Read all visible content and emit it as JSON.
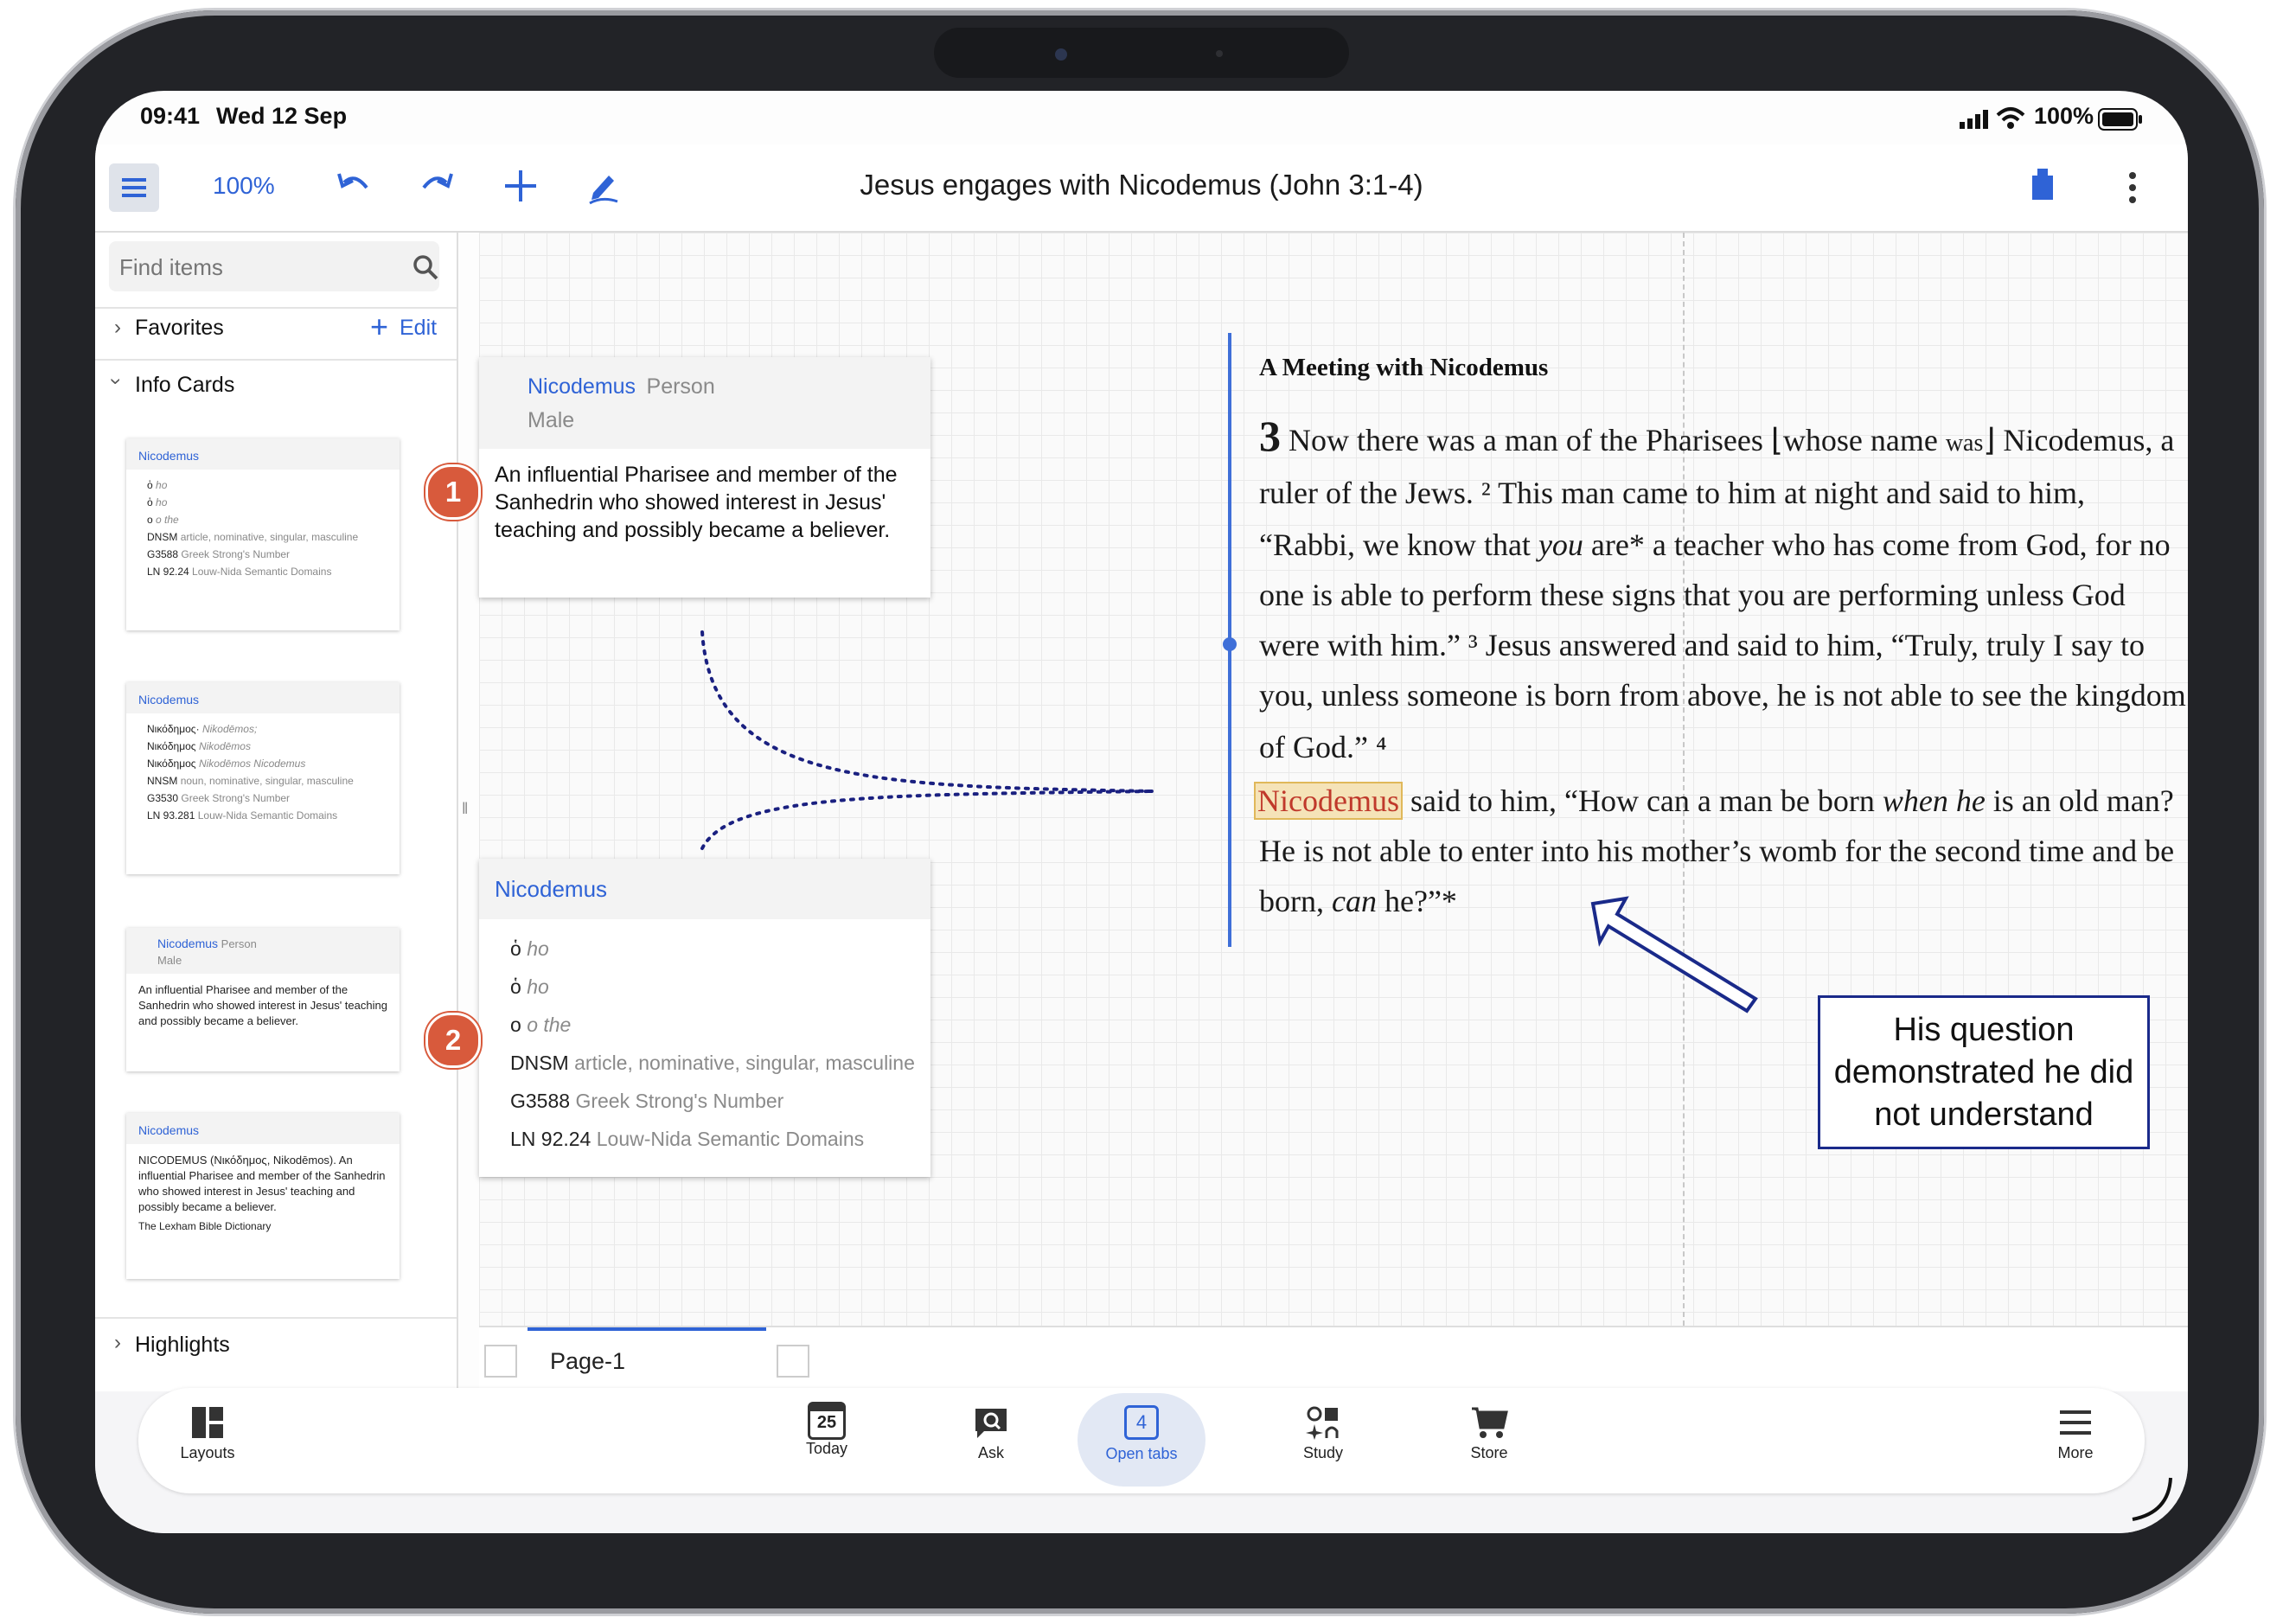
{
  "status_bar": {
    "time": "09:41",
    "date": "Wed 12 Sep",
    "battery": "100%"
  },
  "toolbar": {
    "zoom": "100%",
    "title": "Jesus engages with Nicodemus (John 3:1-4)",
    "icons": [
      "menu-icon",
      "undo-icon",
      "redo-icon",
      "plus-icon",
      "pen-icon",
      "bookmark-icon",
      "more-vertical-icon"
    ]
  },
  "sidebar": {
    "search_placeholder": "Find items",
    "favorites_label": "Favorites",
    "edit_label": "Edit",
    "info_cards_label": "Info Cards",
    "highlights_label": "Highlights",
    "thumbs": {
      "t1": {
        "title": "Nicodemus",
        "rows": [
          {
            "a": "ὁ",
            "b": "ho"
          },
          {
            "a": "ὁ",
            "b": "ho"
          },
          {
            "a": "o",
            "b": "o the"
          },
          {
            "a": "DNSM",
            "b": "article, nominative, singular, masculine"
          },
          {
            "a": "G3588",
            "b": "Greek Strong's Number"
          },
          {
            "a": "LN 92.24",
            "b": "Louw-Nida Semantic Domains"
          }
        ]
      },
      "t2": {
        "title": "Nicodemus",
        "rows": [
          {
            "a": "Νικόδημος·",
            "b": "Nikodēmos;"
          },
          {
            "a": "Νικόδημος",
            "b": "Nikodēmos"
          },
          {
            "a": "Νικόδημος",
            "b": "Nikodēmos Nicodemus"
          },
          {
            "a": "NNSM",
            "b": "noun, nominative, singular, masculine"
          },
          {
            "a": "G3530",
            "b": "Greek Strong's Number"
          },
          {
            "a": "LN 93.281",
            "b": "Louw-Nida Semantic Domains"
          }
        ]
      },
      "t3": {
        "title": "Nicodemus",
        "type": "Person",
        "gender": "Male",
        "body": "An influential Pharisee and member of the Sanhedrin who showed interest in Jesus' teaching and possibly became a believer."
      },
      "t4": {
        "title": "Nicodemus",
        "body": "NICODEMUS (Νικόδημος, Nikodēmos). An influential Pharisee and member of the Sanhedrin who showed interest in Jesus' teaching and possibly became a believer.",
        "source": "The Lexham Bible Dictionary"
      }
    }
  },
  "canvas": {
    "card1": {
      "title": "Nicodemus",
      "type": "Person",
      "gender": "Male",
      "body": "An influential Pharisee and member of the Sanhedrin who showed interest in Jesus' teaching and possibly became a believer.",
      "badge": "1"
    },
    "card2": {
      "title": "Nicodemus",
      "badge": "2",
      "rows": [
        {
          "a": "ὁ",
          "b": "ho"
        },
        {
          "a": "ὁ",
          "b": "ho"
        },
        {
          "a": "o",
          "b": "o the"
        },
        {
          "a": "DNSM",
          "b": "article, nominative, singular, masculine"
        },
        {
          "a": "G3588",
          "b": "Greek Strong's Number"
        },
        {
          "a": "LN 92.24",
          "b": "Louw-Nida Semantic Domains"
        }
      ]
    },
    "heading": "A Meeting with Nicodemus",
    "lines": {
      "l1a": "Now there was a man of the Pharisees ⌊whose name ",
      "l1was": "was",
      "l1b": "⌋ Nicodemus, a",
      "l2": "ruler of the Jews. ² This man came to him at night and said to him,",
      "l3a": "“Rabbi, we know that ",
      "l3you": "you",
      "l3b": " are* a teacher who has come from God, for no",
      "l4": "one is able to perform these signs that you are performing unless God",
      "l5": "were with him.” ³ Jesus answered and said to him, “Truly, truly I say to",
      "l6": "you, unless someone is born from above, he is not able to see the kingdom",
      "l7": "of God.” ⁴",
      "l8name": "Nicodemus",
      "l8a": " said to him, “How can a man be born ",
      "l8when": "when he",
      "l8b": " is an old man?",
      "l9": "He is not able to enter into his mother’s womb for the second time and be",
      "l10a": "born, ",
      "l10can": "can",
      "l10b": " he?”*",
      "chapter": "3"
    },
    "callout": "His question demonstrated he did not understand"
  },
  "page_tabs": {
    "active": "Page-1"
  },
  "bottom_nav": {
    "layouts": "Layouts",
    "today": "Today",
    "today_day": "25",
    "ask": "Ask",
    "open_tabs": "Open tabs",
    "open_tabs_count": "4",
    "study": "Study",
    "store": "Store",
    "more": "More"
  },
  "colors": {
    "accent": "#2f63d6",
    "badge": "#d85a3c",
    "callout_border": "#1a2a8a",
    "highlight": "#f5e3b8"
  }
}
